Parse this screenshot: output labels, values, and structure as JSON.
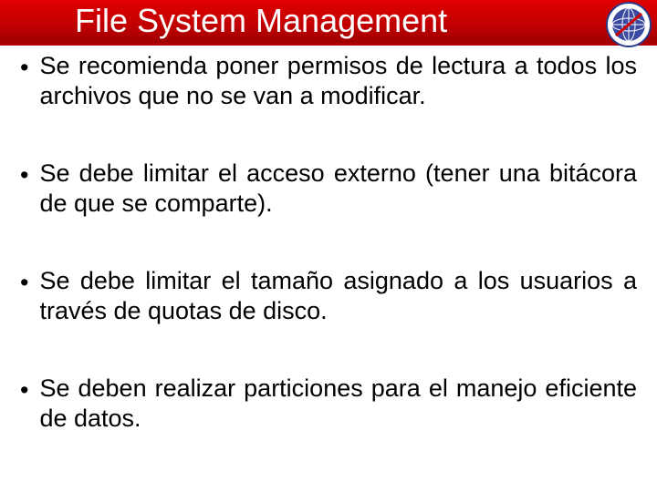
{
  "header": {
    "title": "File System Management"
  },
  "bullets": [
    {
      "text": "Se recomienda poner permisos de lectura a todos los archivos que no se van a modificar."
    },
    {
      "text": "Se debe limitar el acceso externo (tener una bitácora de que se comparte)."
    },
    {
      "text": "Se debe limitar el tamaño asignado a los usuarios a través de quotas de disco."
    },
    {
      "text": "Se deben realizar particiones para el manejo eficiente de datos."
    }
  ]
}
